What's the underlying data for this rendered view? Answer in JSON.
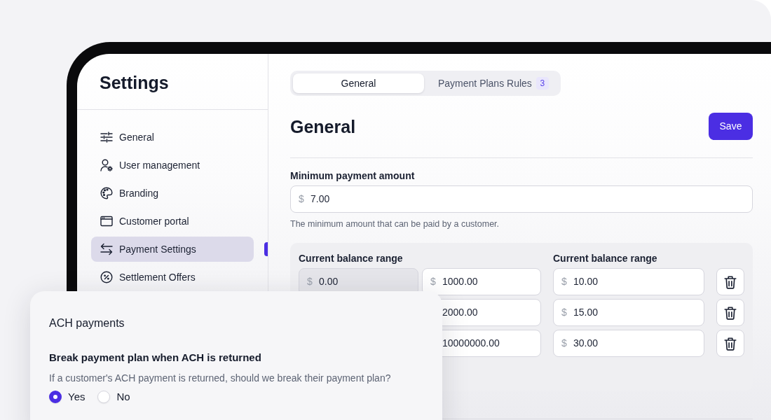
{
  "sidebar": {
    "title": "Settings",
    "items": [
      {
        "label": "General",
        "selected": false
      },
      {
        "label": "User management",
        "selected": false
      },
      {
        "label": "Branding",
        "selected": false
      },
      {
        "label": "Customer portal",
        "selected": false
      },
      {
        "label": "Payment Settings",
        "selected": true
      },
      {
        "label": "Settlement Offers",
        "selected": false
      }
    ]
  },
  "tabs": [
    {
      "label": "General",
      "selected": true
    },
    {
      "label": "Payment Plans Rules",
      "selected": false,
      "badge": "3"
    }
  ],
  "header": {
    "heading": "General",
    "save_button": "Save"
  },
  "minimum_payment": {
    "label": "Minimum payment amount",
    "prefix": "$",
    "value": "7.00",
    "help": "The minimum amount that can be paid by a customer."
  },
  "ranges": {
    "column_labels": [
      "Current balance range",
      "Current balance range"
    ],
    "rows": [
      {
        "from": {
          "prefix": "$",
          "value": "0.00",
          "disabled": true
        },
        "to": {
          "prefix": "$",
          "value": "1000.00",
          "disabled": false
        },
        "amount": {
          "prefix": "$",
          "value": "10.00",
          "disabled": false
        }
      },
      {
        "to": {
          "value": "2000.00",
          "disabled": false
        },
        "amount": {
          "prefix": "$",
          "value": "15.00",
          "disabled": false
        }
      },
      {
        "to": {
          "value": "10000000.00",
          "disabled": false
        },
        "amount": {
          "prefix": "$",
          "value": "30.00",
          "disabled": false
        }
      }
    ]
  },
  "ach_card": {
    "title": "ACH payments",
    "question": "Break payment plan when ACH is returned",
    "description": "If a customer's ACH payment is returned, should we break their payment plan?",
    "options": [
      {
        "label": "Yes",
        "selected": true
      },
      {
        "label": "No",
        "selected": false
      }
    ]
  }
}
